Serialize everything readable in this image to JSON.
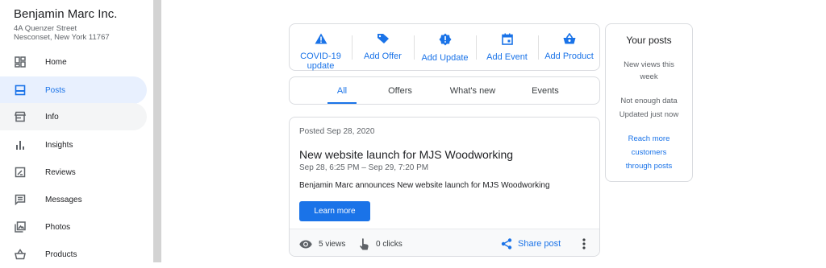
{
  "business": {
    "name": "Benjamin Marc Inc.",
    "address_line1": "4A Quenzer Street",
    "address_line2": "Nesconset, New York 11767"
  },
  "sidebar": {
    "items": [
      {
        "label": "Home",
        "icon": "dashboard-icon"
      },
      {
        "label": "Posts",
        "icon": "posts-icon",
        "active": true
      },
      {
        "label": "Info",
        "icon": "storefront-icon"
      },
      {
        "label": "Insights",
        "icon": "bar-chart-icon"
      },
      {
        "label": "Reviews",
        "icon": "reviews-icon"
      },
      {
        "label": "Messages",
        "icon": "message-icon"
      },
      {
        "label": "Photos",
        "icon": "photos-icon"
      },
      {
        "label": "Products",
        "icon": "basket-icon"
      }
    ]
  },
  "actions": [
    {
      "label": "COVID-19 update",
      "line1": "COVID-19",
      "line2": "update",
      "icon": "warning-icon"
    },
    {
      "label": "Add Offer",
      "icon": "tag-icon"
    },
    {
      "label": "Add Update",
      "icon": "alert-badge-icon"
    },
    {
      "label": "Add Event",
      "icon": "calendar-icon"
    },
    {
      "label": "Add Product",
      "icon": "basket-icon"
    }
  ],
  "tabs": [
    {
      "label": "All",
      "active": true
    },
    {
      "label": "Offers"
    },
    {
      "label": "What's new"
    },
    {
      "label": "Events"
    }
  ],
  "post": {
    "posted": "Posted Sep 28, 2020",
    "title": "New website launch for MJS Woodworking",
    "range": "Sep 28, 6:25 PM – Sep 29, 7:20 PM",
    "body": "Benjamin Marc announces New website launch for MJS Woodworking",
    "button": "Learn more",
    "views": "5 views",
    "clicks": "0 clicks",
    "share": "Share post"
  },
  "your_posts": {
    "title": "Your posts",
    "views_label_1": "New views this",
    "views_label_2": "week",
    "status_1": "Not enough data",
    "status_2": "Updated just now",
    "link_1": "Reach more",
    "link_2": "customers",
    "link_3": "through posts"
  },
  "colors": {
    "accent": "#1a73e8",
    "active_bg": "#e8f0fe",
    "icon_grey": "#5f6368"
  }
}
